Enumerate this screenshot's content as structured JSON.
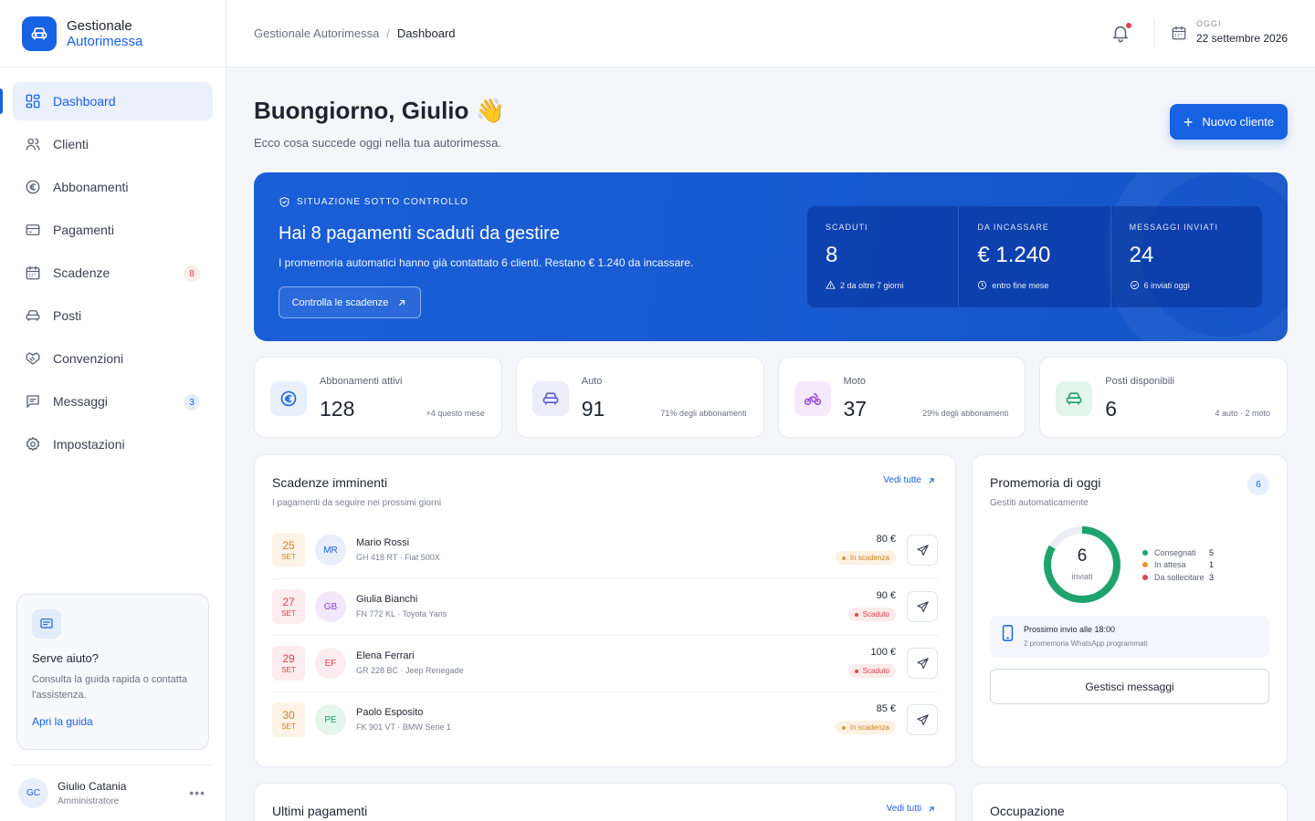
{
  "brand": {
    "line1": "Gestionale",
    "line2": "Autorimessa"
  },
  "nav": [
    {
      "label": "Dashboard",
      "icon": "grid-icon",
      "active": true
    },
    {
      "label": "Clienti",
      "icon": "users-icon"
    },
    {
      "label": "Abbonamenti",
      "icon": "euro-icon"
    },
    {
      "label": "Pagamenti",
      "icon": "card-icon"
    },
    {
      "label": "Scadenze",
      "icon": "calendar-icon",
      "badge": "8"
    },
    {
      "label": "Posti",
      "icon": "car-icon"
    },
    {
      "label": "Convenzioni",
      "icon": "handshake-icon"
    },
    {
      "label": "Messaggi",
      "icon": "message-icon",
      "badge": "3"
    },
    {
      "label": "Impostazioni",
      "icon": "gear-icon"
    }
  ],
  "help": {
    "title": "Serve aiuto?",
    "text": "Consulta la guida rapida o contatta l'assistenza.",
    "link": "Apri la guida"
  },
  "user": {
    "initials": "GC",
    "name": "Giulio Catania",
    "role": "Amministratore"
  },
  "header": {
    "crumb_root": "Gestionale Autorimessa",
    "crumb_sep": "/",
    "crumb_current": "Dashboard",
    "today_label": "OGGI",
    "today_value": "22 settembre 2026"
  },
  "page": {
    "greeting": "Buongiorno, Giulio 👋",
    "subtitle": "Ecco cosa succede oggi nella tua autorimessa.",
    "new_client": "Nuovo cliente"
  },
  "hero": {
    "tag": "SITUAZIONE SOTTO CONTROLLO",
    "title": "Hai 8 pagamenti scaduti da gestire",
    "text": "I promemoria automatici hanno già contattato 6 clienti. Restano € 1.240 da incassare.",
    "button": "Controlla le scadenze",
    "stats": [
      {
        "label": "SCADUTI",
        "value": "8",
        "sub": "2 da oltre 7 giorni"
      },
      {
        "label": "DA INCASSARE",
        "value": "€ 1.240",
        "sub": "entro fine mese"
      },
      {
        "label": "MESSAGGI INVIATI",
        "value": "24",
        "sub": "6 inviati oggi"
      }
    ]
  },
  "kpis": [
    {
      "label": "Abbonamenti attivi",
      "value": "128",
      "sub": "+4 questo mese",
      "icon": "euro-icon",
      "color": "#1662e3"
    },
    {
      "label": "Auto",
      "value": "91",
      "sub": "71% degli abbonamenti",
      "icon": "car-icon",
      "color": "#5b5bd6"
    },
    {
      "label": "Moto",
      "value": "37",
      "sub": "29% degli abbonamenti",
      "icon": "bike-icon",
      "color": "#9b4fd1"
    },
    {
      "label": "Posti disponibili",
      "value": "6",
      "sub": "4 auto · 2 moto",
      "icon": "car-icon",
      "color": "#1f9d6a"
    }
  ],
  "deadlines": {
    "title": "Scadenze imminenti",
    "subtitle": "I pagamenti da seguire nei prossimi giorni",
    "link": "Vedi tutte",
    "rows": [
      {
        "day": "25",
        "month": "SET",
        "initials": "MR",
        "name": "Mario Rossi",
        "plate": "GH 418 RT · Fiat 500X",
        "amount": "80 €",
        "status": "In scadenza",
        "kind": "warn"
      },
      {
        "day": "27",
        "month": "SET",
        "initials": "GB",
        "name": "Giulia Bianchi",
        "plate": "FN 772 KL · Toyota Yaris",
        "amount": "90 €",
        "status": "Scaduto",
        "kind": "err"
      },
      {
        "day": "29",
        "month": "SET",
        "initials": "EF",
        "name": "Elena Ferrari",
        "plate": "GR 228 BC · Jeep Renegade",
        "amount": "100 €",
        "status": "Scaduto",
        "kind": "err"
      },
      {
        "day": "30",
        "month": "SET",
        "initials": "PE",
        "name": "Paolo Esposito",
        "plate": "FK 901 VT · BMW Serie 1",
        "amount": "85 €",
        "status": "In scadenza",
        "kind": "warn"
      }
    ]
  },
  "reminders": {
    "title": "Promemoria di oggi",
    "subtitle": "Gestiti automaticamente",
    "count": "6",
    "donut_value": "6",
    "donut_label": "inviati",
    "legend": [
      {
        "label": "Consegnati",
        "value": 5,
        "color": "#1fa36e"
      },
      {
        "label": "In attesa",
        "value": 1,
        "color": "#e3962f"
      },
      {
        "label": "Da sollecitare",
        "value": 3,
        "color": "#e04450"
      }
    ],
    "next_title": "Prossimo invio alle 18:00",
    "next_sub": "2 promemoria WhatsApp programmati",
    "button": "Gestisci messaggi"
  },
  "payments": {
    "title": "Ultimi pagamenti",
    "link": "Vedi tutti"
  },
  "occupancy": {
    "title": "Occupazione"
  }
}
